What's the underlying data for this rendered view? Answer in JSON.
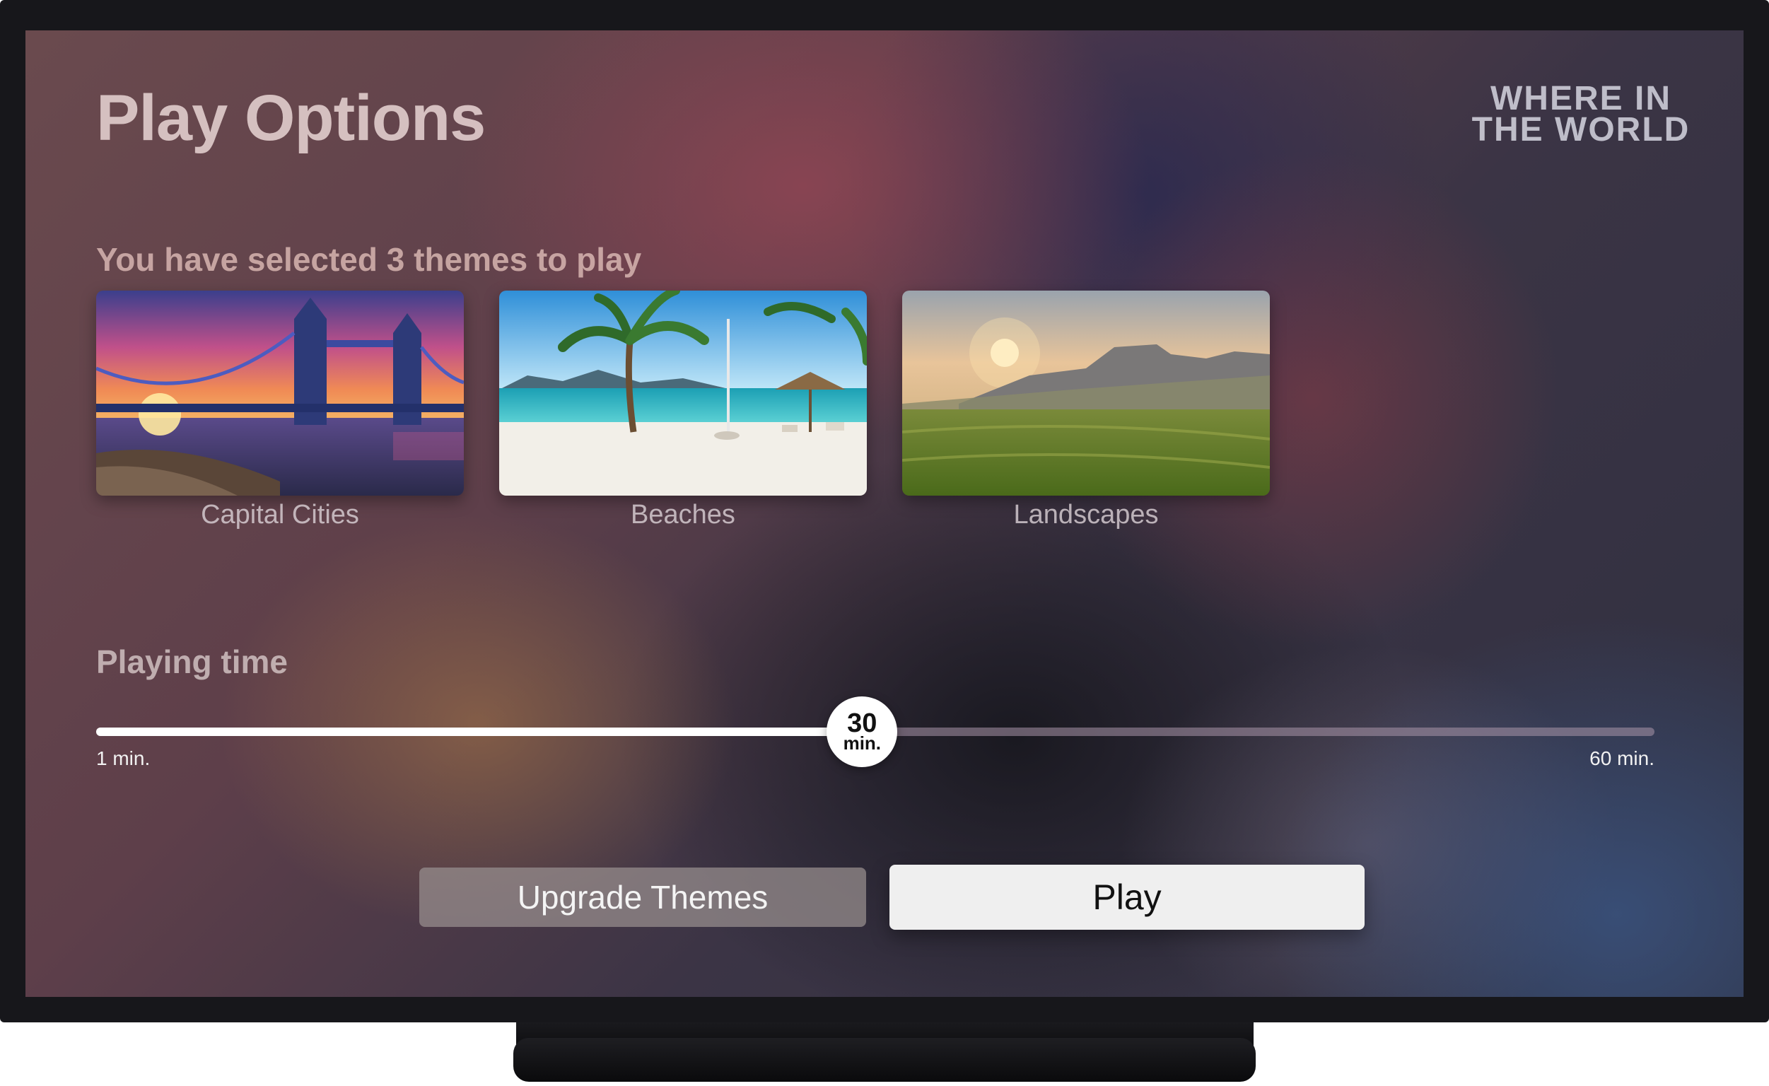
{
  "header": {
    "title": "Play Options",
    "logo_line1": "WHERE IN",
    "logo_line2_a": "THE W",
    "logo_line2_o": "O",
    "logo_line2_b": "RLD"
  },
  "selection": {
    "text": "You have selected 3 themes to play",
    "themes": [
      {
        "label": "Capital Cities",
        "image": "tower-bridge-sunset"
      },
      {
        "label": "Beaches",
        "image": "palm-beach"
      },
      {
        "label": "Landscapes",
        "image": "green-plateau-sunset"
      }
    ]
  },
  "playing_time": {
    "label": "Playing time",
    "value": "30",
    "unit": "min.",
    "min_label": "1 min.",
    "max_label": "60 min.",
    "min_value": 1,
    "max_value": 60,
    "current_value": 30
  },
  "actions": {
    "upgrade_label": "Upgrade Themes",
    "play_label": "Play"
  },
  "colors": {
    "accent": "#ffffff",
    "button_focused": "#efefef",
    "button_unfocused": "#968c8c"
  }
}
